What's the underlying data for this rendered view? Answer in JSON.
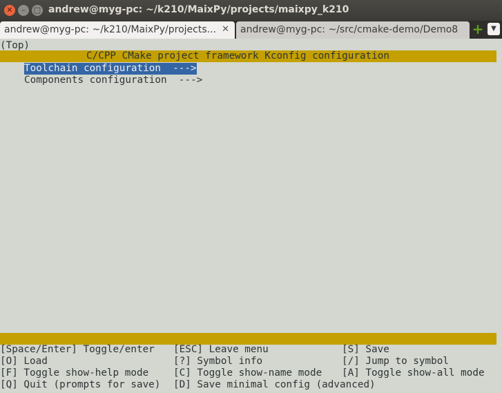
{
  "window": {
    "title": "andrew@myg-pc: ~/k210/MaixPy/projects/maixpy_k210",
    "close_glyph": "✕",
    "min_glyph": "–",
    "max_glyph": "□"
  },
  "tabs": [
    {
      "label": "andrew@myg-pc: ~/k210/MaixPy/projects...",
      "close": "✕",
      "active": true
    },
    {
      "label": "andrew@myg-pc: ~/src/cmake-demo/Demo8",
      "active": false
    }
  ],
  "tabbar": {
    "new_tab_glyph": "+",
    "menu_glyph": "▼"
  },
  "menuconfig": {
    "breadcrumb": "(Top)",
    "header": "C/CPP CMake project framework Kconfig configuration",
    "items": [
      {
        "label": "Toolchain configuration  --->",
        "selected": true
      },
      {
        "label": "Components configuration  --->",
        "selected": false
      }
    ],
    "help": [
      [
        "[Space/Enter] Toggle/enter",
        "[ESC] Leave menu",
        "[S] Save"
      ],
      [
        "[O] Load",
        "[?] Symbol info",
        "[/] Jump to symbol"
      ],
      [
        "[F] Toggle show-help mode",
        "[C] Toggle show-name mode",
        "[A] Toggle show-all mode"
      ],
      [
        "[Q] Quit (prompts for save)",
        "[D] Save minimal config (advanced)",
        ""
      ]
    ]
  },
  "colors": {
    "terminal_bg": "#d3d7cf",
    "header_bar": "#c4a000",
    "selection": "#3465a4"
  }
}
